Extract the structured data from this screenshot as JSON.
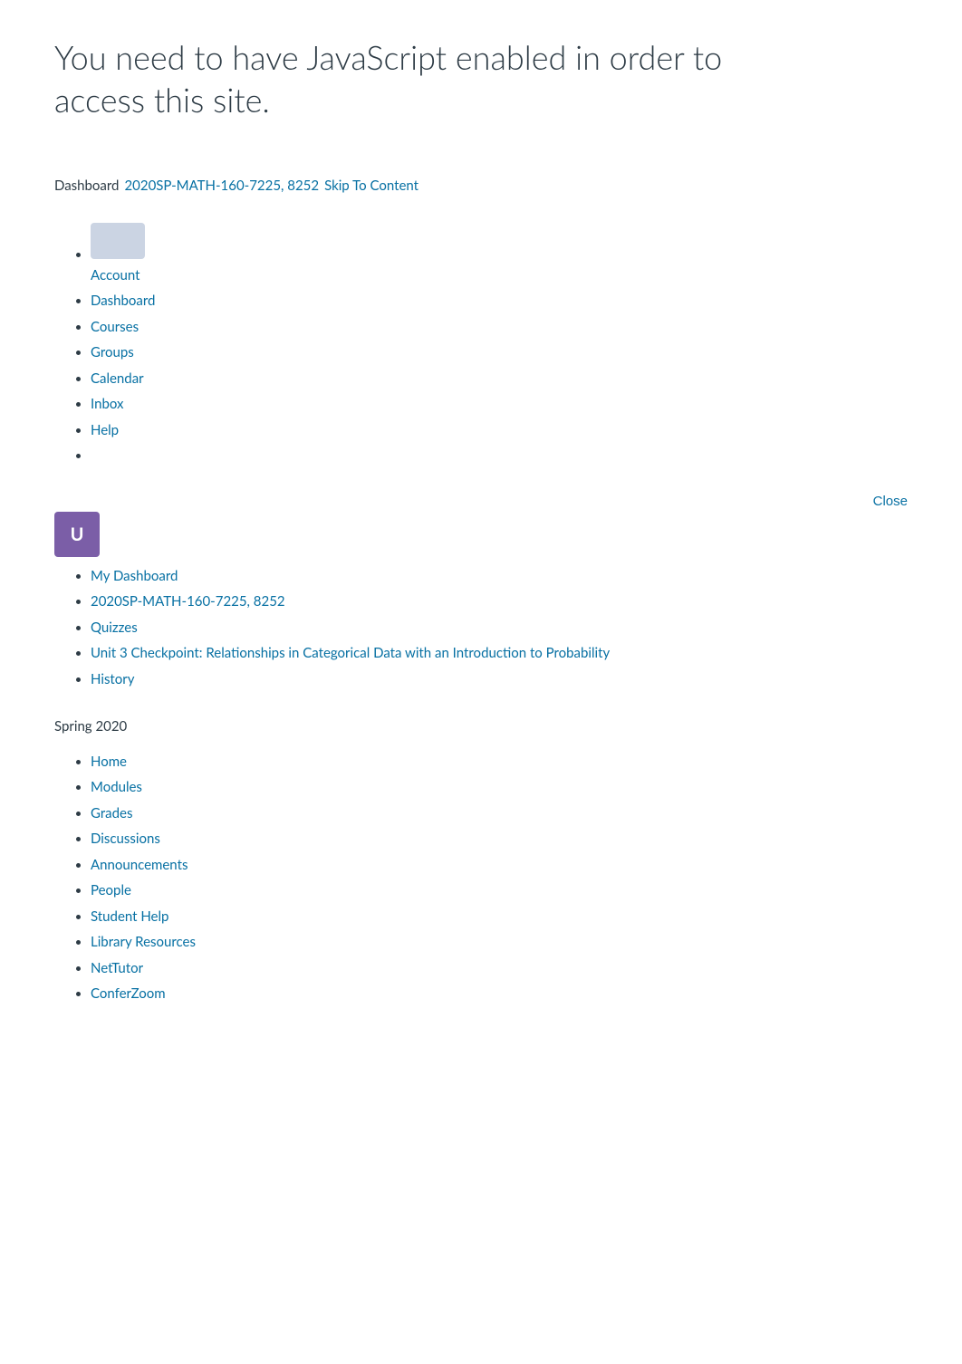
{
  "warning": {
    "text": "You need to have JavaScript enabled in order to access this site."
  },
  "breadcrumb": {
    "dashboard_label": "Dashboard",
    "course_link_text": "2020SP-MATH-160-7225, 8252",
    "skip_link_text": "Skip To Content"
  },
  "global_nav": {
    "account_label": "Account",
    "items": [
      {
        "label": "Dashboard",
        "href": "#"
      },
      {
        "label": "Courses",
        "href": "#"
      },
      {
        "label": "Groups",
        "href": "#"
      },
      {
        "label": "Calendar",
        "href": "#"
      },
      {
        "label": "Inbox",
        "href": "#"
      },
      {
        "label": "Help",
        "href": "#"
      }
    ]
  },
  "sidebar": {
    "close_label": "Close",
    "nav_items": [
      {
        "label": "My Dashboard",
        "href": "#"
      },
      {
        "label": "2020SP-MATH-160-7225, 8252",
        "href": "#"
      },
      {
        "label": "Quizzes",
        "href": "#"
      },
      {
        "label": "Unit 3 Checkpoint: Relationships in Categorical Data with an Introduction to Probability",
        "href": "#"
      },
      {
        "label": "History",
        "href": "#"
      }
    ]
  },
  "course": {
    "term": "Spring 2020",
    "nav_items": [
      {
        "label": "Home",
        "href": "#"
      },
      {
        "label": "Modules",
        "href": "#"
      },
      {
        "label": "Grades",
        "href": "#"
      },
      {
        "label": "Discussions",
        "href": "#"
      },
      {
        "label": "Announcements",
        "href": "#"
      },
      {
        "label": "People",
        "href": "#"
      },
      {
        "label": "Student Help",
        "href": "#"
      },
      {
        "label": "Library Resources",
        "href": "#"
      },
      {
        "label": "NetTutor",
        "href": "#"
      },
      {
        "label": "ConferZoom",
        "href": "#"
      }
    ]
  }
}
